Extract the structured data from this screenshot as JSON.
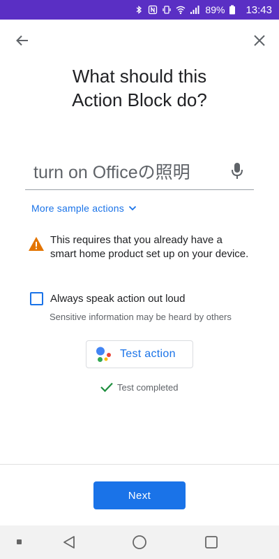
{
  "status_bar": {
    "battery": "89%",
    "time": "13:43",
    "background_color": "#5a2fc4",
    "icons": [
      "bluetooth-icon",
      "nfc-icon",
      "vibrate-icon",
      "wifi-icon",
      "signal-icon",
      "battery-icon"
    ]
  },
  "header": {
    "back_icon": "arrow-back-icon",
    "close_icon": "close-icon"
  },
  "title": {
    "line1": "What should this",
    "line2": "Action Block do?"
  },
  "command": {
    "value": "turn on Officeの照明",
    "mic_icon": "mic-icon"
  },
  "more_actions": {
    "label": "More sample actions",
    "icon": "chevron-down-icon"
  },
  "warning": {
    "icon": "warning-icon",
    "text": "This requires that you already have a smart home product set up on your device."
  },
  "speak_option": {
    "label": "Always speak action out loud",
    "hint": "Sensitive information may be heard by others",
    "checked": false
  },
  "test_button": {
    "label": "Test action",
    "icon": "google-assistant-icon"
  },
  "test_status": {
    "label": "Test completed",
    "icon": "checkmark-icon"
  },
  "footer": {
    "next_label": "Next"
  },
  "colors": {
    "accent": "#1a73e8",
    "warning": "#e37400",
    "success": "#1e8e3e"
  }
}
